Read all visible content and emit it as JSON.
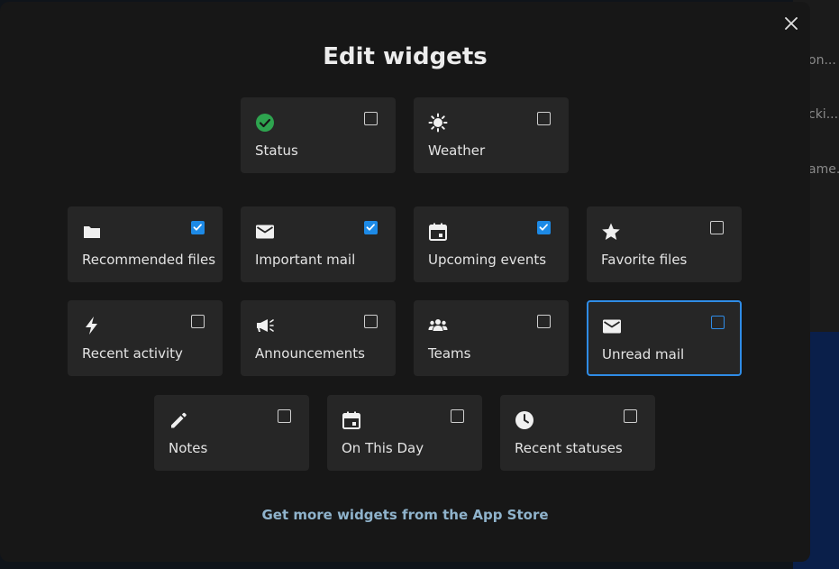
{
  "background": {
    "snippets": [
      "on...",
      "cki...",
      "ame..."
    ]
  },
  "modal": {
    "title": "Edit widgets",
    "close_label": "Close",
    "store_link": "Get more widgets from the App Store"
  },
  "colors": {
    "accent": "#1d8ae6",
    "focus": "#2f8ce6",
    "status_green": "#2ea44f"
  },
  "widgets": [
    {
      "label": "Status",
      "icon": "check-circle-icon",
      "checked": false
    },
    {
      "label": "Weather",
      "icon": "sun-icon",
      "checked": false
    },
    {
      "label": "Recommended files",
      "icon": "folder-icon",
      "checked": true
    },
    {
      "label": "Important mail",
      "icon": "mail-icon",
      "checked": true
    },
    {
      "label": "Upcoming events",
      "icon": "calendar-icon",
      "checked": true
    },
    {
      "label": "Favorite files",
      "icon": "star-icon",
      "checked": false
    },
    {
      "label": "Recent activity",
      "icon": "lightning-icon",
      "checked": false
    },
    {
      "label": "Announcements",
      "icon": "megaphone-icon",
      "checked": false
    },
    {
      "label": "Teams",
      "icon": "people-icon",
      "checked": false
    },
    {
      "label": "Unread mail",
      "icon": "mail-icon",
      "checked": false
    },
    {
      "label": "Notes",
      "icon": "pencil-icon",
      "checked": false
    },
    {
      "label": "On This Day",
      "icon": "calendar-icon",
      "checked": false
    },
    {
      "label": "Recent statuses",
      "icon": "clock-icon",
      "checked": false
    }
  ]
}
